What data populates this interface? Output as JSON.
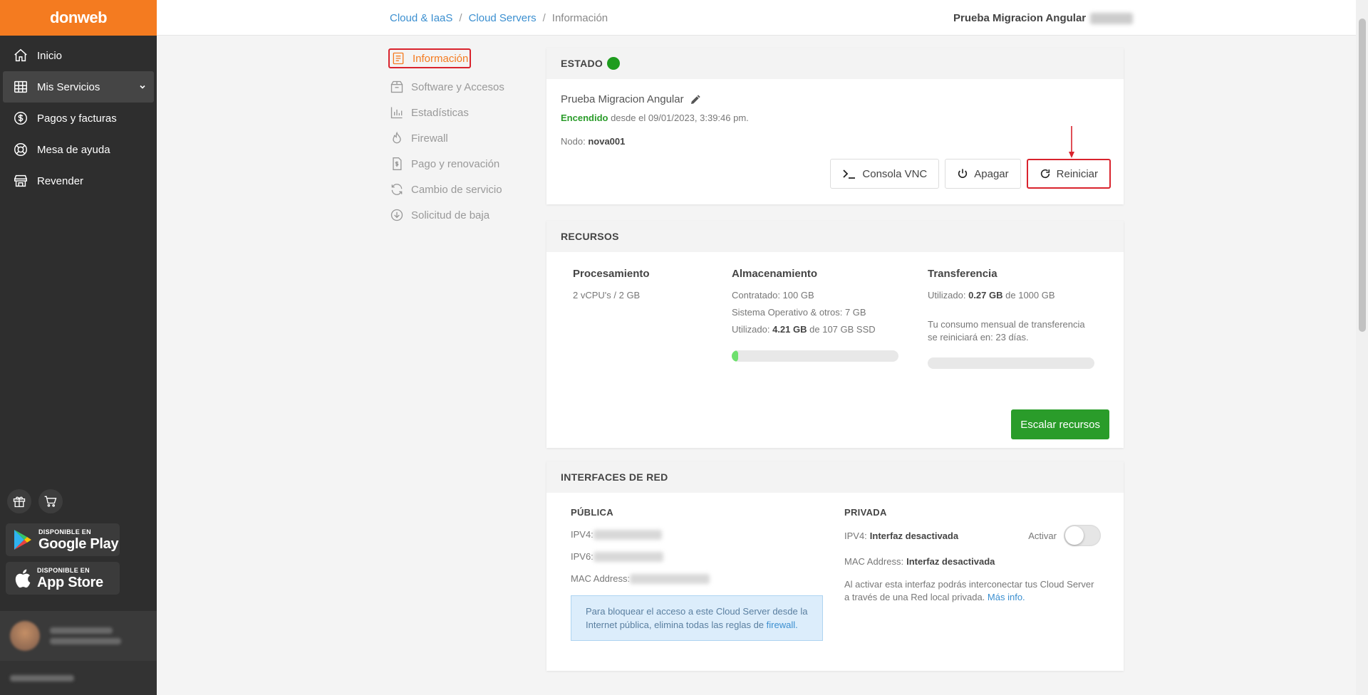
{
  "brand": "donweb",
  "sidebar": {
    "items": [
      {
        "label": "Inicio",
        "icon": "home-icon"
      },
      {
        "label": "Mis Servicios",
        "icon": "grid-icon",
        "active": true
      },
      {
        "label": "Pagos y facturas",
        "icon": "dollar-icon"
      },
      {
        "label": "Mesa de ayuda",
        "icon": "lifebuoy-icon"
      },
      {
        "label": "Revender",
        "icon": "store-icon"
      }
    ],
    "google_play": {
      "small": "DISPONIBLE EN",
      "big": "Google Play"
    },
    "app_store": {
      "small": "DISPONIBLE EN",
      "big": "App Store"
    }
  },
  "breadcrumb": {
    "first": "Cloud & IaaS",
    "second": "Cloud Servers",
    "current": "Información"
  },
  "header": {
    "title": "Prueba Migracion Angular"
  },
  "submenu": [
    {
      "label": "Información",
      "icon": "document-icon",
      "active": true
    },
    {
      "label": "Software y Accesos",
      "icon": "package-icon"
    },
    {
      "label": "Estadísticas",
      "icon": "bar-chart-icon"
    },
    {
      "label": "Firewall",
      "icon": "flame-icon"
    },
    {
      "label": "Pago y renovación",
      "icon": "invoice-icon"
    },
    {
      "label": "Cambio de servicio",
      "icon": "refresh-icon"
    },
    {
      "label": "Solicitud de baja",
      "icon": "arrow-down-circle-icon"
    }
  ],
  "estado": {
    "title": "ESTADO",
    "status_color": "#1e9c1e",
    "server_name": "Prueba Migracion Angular",
    "status_word": "Encendido",
    "since": "desde el 09/01/2023, 3:39:46 pm.",
    "node_label": "Nodo:",
    "node_value": "nova001",
    "btn_vnc": "Consola VNC",
    "btn_off": "Apagar",
    "btn_restart": "Reiniciar"
  },
  "recursos": {
    "title": "RECURSOS",
    "proc": {
      "title": "Procesamiento",
      "value": "2 vCPU's / 2 GB"
    },
    "alm": {
      "title": "Almacenamiento",
      "contratado": "Contratado: 100 GB",
      "so": "Sistema Operativo & otros: 7 GB",
      "used_label": "Utilizado:",
      "used_value": "4.21 GB",
      "used_rest": "de 107 GB SSD",
      "fill_fraction": 0.039
    },
    "trans": {
      "title": "Transferencia",
      "used_label": "Utilizado:",
      "used_value": "0.27 GB",
      "used_rest": "de 1000 GB",
      "note": "Tu consumo mensual de transferencia se reiniciará en: 23 días.",
      "fill_fraction": 0.0003
    },
    "btn_scale": "Escalar recursos",
    "accent": "#2a9c2a"
  },
  "red": {
    "title": "INTERFACES DE RED",
    "publica": "PÚBLICA",
    "ipv4_label": "IPV4:",
    "ipv6_label": "IPV6:",
    "mac_label": "MAC Address:",
    "info_text": "Para bloquear el acceso a este Cloud Server desde la Internet pública, elimina todas las reglas de",
    "info_link": "firewall.",
    "privada": "PRIVADA",
    "priv_ipv4_label": "IPV4:",
    "priv_ipv4_value": "Interfaz desactivada",
    "activar": "Activar",
    "priv_mac_label": "MAC Address:",
    "priv_mac_value": "Interfaz desactivada",
    "priv_note": "Al activar esta interfaz podrás interconectar tus Cloud Server a través de una Red local privada.",
    "priv_link": "Más info."
  }
}
